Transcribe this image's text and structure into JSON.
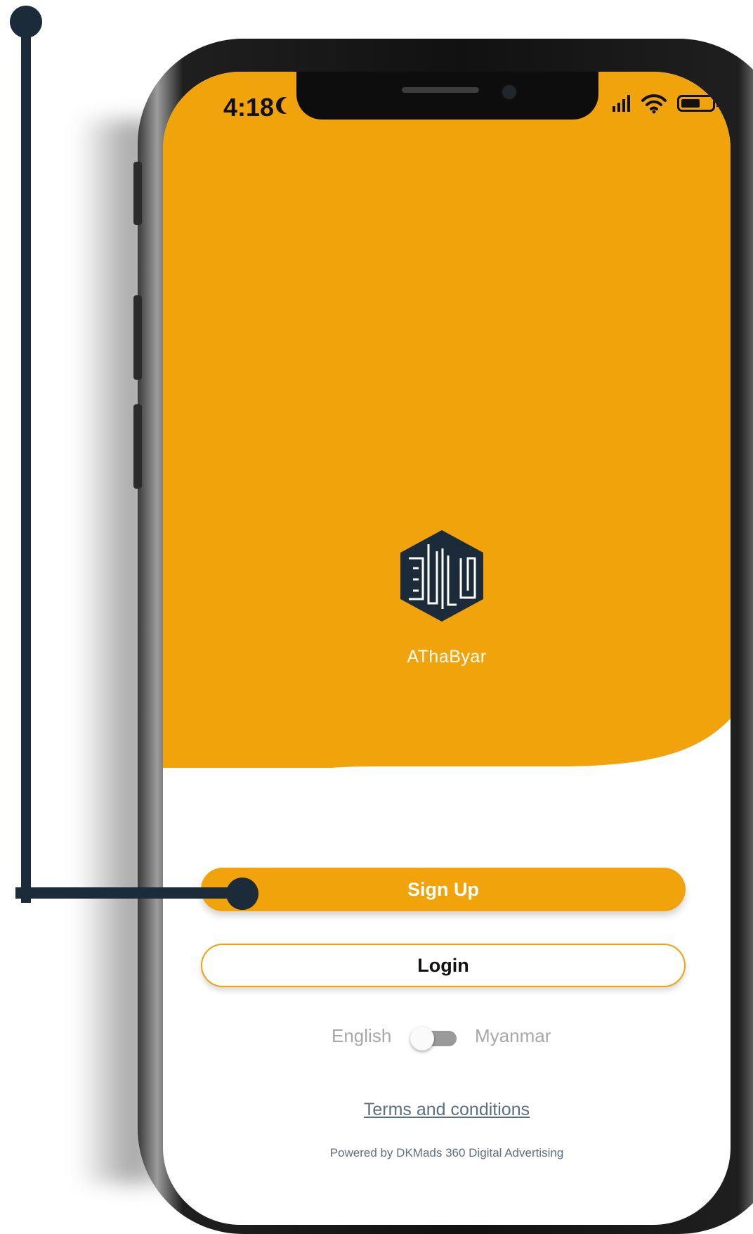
{
  "status_bar": {
    "time": "4:18"
  },
  "app": {
    "name": "AThaByar"
  },
  "actions": {
    "signup_label": "Sign Up",
    "login_label": "Login"
  },
  "language": {
    "left_label": "English",
    "right_label": "Myanmar",
    "selected": "English"
  },
  "footer": {
    "terms_label": "Terms and conditions",
    "powered_by": "Powered by DKMads 360 Digital Advertising"
  },
  "colors": {
    "accent": "#f0a30a",
    "callout": "#1b2b3a",
    "link": "#5c6f80"
  },
  "icons": [
    "moon-icon",
    "signal-icon",
    "wifi-icon",
    "battery-icon",
    "app-logo-icon"
  ]
}
